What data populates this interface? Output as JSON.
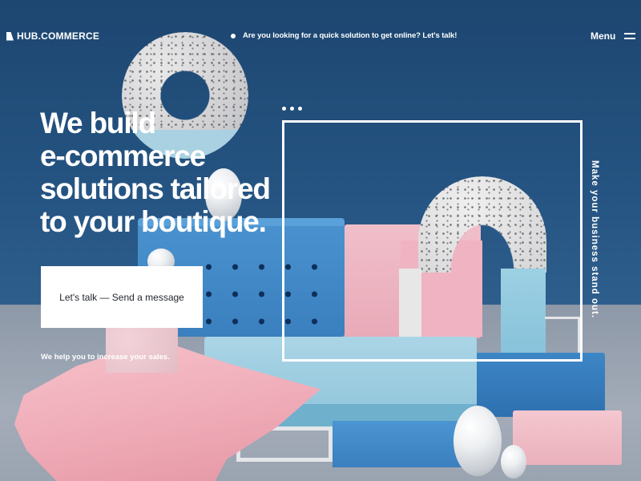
{
  "header": {
    "brand": "HUB.COMMERCE",
    "announcement": "Are you looking for a quick solution to get online? Let's talk!",
    "menu_label": "Menu"
  },
  "hero": {
    "headline_lines": [
      "We build",
      "e-commerce",
      "solutions tailored",
      "to your boutique."
    ],
    "cta_label": "Let's talk — Send a message",
    "subtext": "We help you to increase your sales."
  },
  "side": {
    "tagline": "Make your business stand out."
  },
  "colors": {
    "background": "#1f4a72",
    "text": "#ffffff",
    "cta_background": "#ffffff",
    "cta_text": "#23272e"
  },
  "icons": [
    "logo-mark-icon",
    "bullet-dot-icon",
    "hamburger-menu-icon",
    "ellipsis-dots-icon"
  ]
}
